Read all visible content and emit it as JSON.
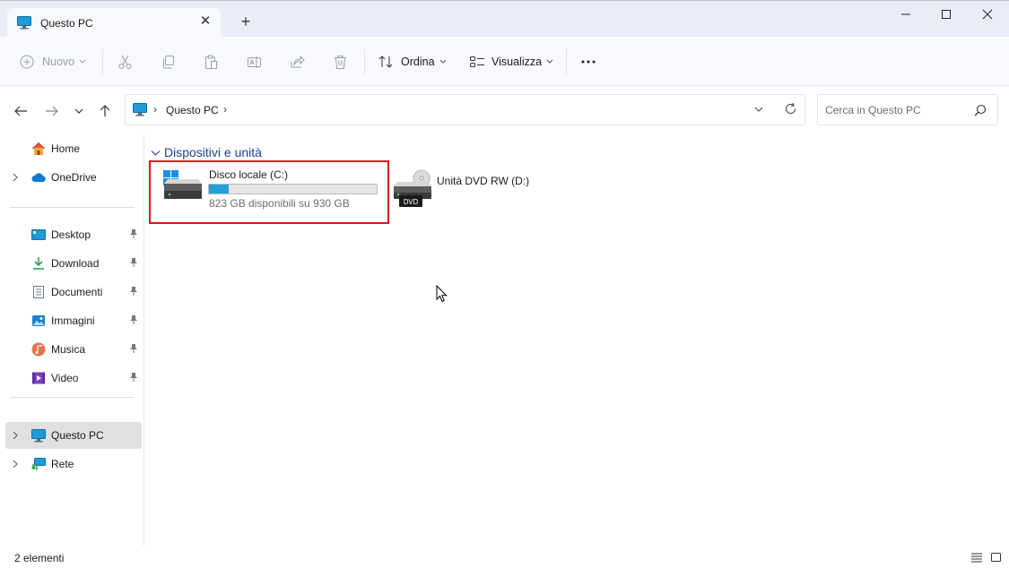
{
  "window": {
    "tab_title": "Questo PC",
    "tab_close_glyph": "✕",
    "new_tab_glyph": "+",
    "minimize_glyph": "—",
    "maximize_glyph": "☐",
    "close_glyph": "✕"
  },
  "toolbar": {
    "new_label": "Nuovo",
    "sort_label": "Ordina",
    "view_label": "Visualizza",
    "more_label": "···"
  },
  "address": {
    "crumb": "Questo PC",
    "separator": "›"
  },
  "search": {
    "placeholder": "Cerca in Questo PC"
  },
  "sidebar": {
    "items": [
      {
        "label": "Home",
        "icon": "home-icon"
      },
      {
        "label": "OneDrive",
        "icon": "cloud-icon"
      },
      {
        "label": "Desktop",
        "icon": "desktop-icon"
      },
      {
        "label": "Download",
        "icon": "download-icon"
      },
      {
        "label": "Documenti",
        "icon": "documents-icon"
      },
      {
        "label": "Immagini",
        "icon": "pictures-icon"
      },
      {
        "label": "Musica",
        "icon": "music-icon"
      },
      {
        "label": "Video",
        "icon": "video-icon"
      },
      {
        "label": "Questo PC",
        "icon": "this-pc-icon"
      },
      {
        "label": "Rete",
        "icon": "network-icon"
      }
    ],
    "chevron": "›"
  },
  "content": {
    "section_title": "Dispositivi e unità",
    "drives": [
      {
        "name": "Disco locale (C:)",
        "free_text": "823 GB disponibili su 930 GB",
        "used_fraction": 0.115
      },
      {
        "name": "Unità DVD RW (D:)",
        "badge": "DVD"
      }
    ]
  },
  "status": {
    "count": "2 elementi"
  },
  "colors": {
    "accent": "#26a0da",
    "highlight_border": "#e0141c",
    "section_blue": "#1e3f98"
  }
}
